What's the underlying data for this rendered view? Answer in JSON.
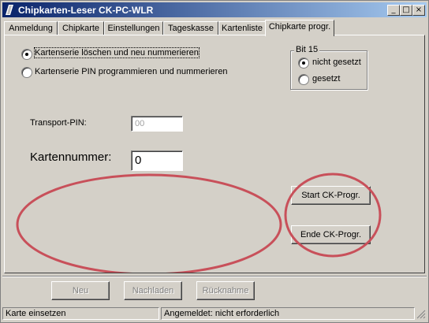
{
  "window": {
    "title": "Chipkarten-Leser CK-PC-WLR"
  },
  "titlebar_buttons": {
    "minimize": "_",
    "maximize": "□",
    "close": "×"
  },
  "tabs": [
    {
      "label": "Anmeldung"
    },
    {
      "label": "Chipkarte"
    },
    {
      "label": "Einstellungen"
    },
    {
      "label": "Tageskasse"
    },
    {
      "label": "Kartenliste"
    },
    {
      "label": "Chipkarte progr."
    }
  ],
  "active_tab": "Chipkarte progr.",
  "mode": {
    "option_erase": "Kartenserie löschen und neu nummerieren",
    "option_pin": "Kartenserie PIN programmieren und nummerieren",
    "selected": "Kartenserie löschen und neu nummerieren"
  },
  "bit15": {
    "legend": "Bit 15",
    "option_not_set": "nicht gesetzt",
    "option_set": "gesetzt",
    "selected": "nicht gesetzt"
  },
  "transport_pin": {
    "label": "Transport-PIN:",
    "value": "00"
  },
  "card_number": {
    "label": "Kartennummer:",
    "value": "0"
  },
  "buttons": {
    "start": "Start CK-Progr.",
    "end": "Ende CK-Progr."
  },
  "bottom_buttons": {
    "new": "Neu",
    "reload": "Nachladen",
    "withdraw": "Rücknahme"
  },
  "status": {
    "left": "Karte einsetzen",
    "right": "Angemeldet: nicht erforderlich"
  },
  "colors": {
    "titlebar_start": "#0a246a",
    "titlebar_end": "#a6caf0",
    "annotation": "#c8505a"
  }
}
